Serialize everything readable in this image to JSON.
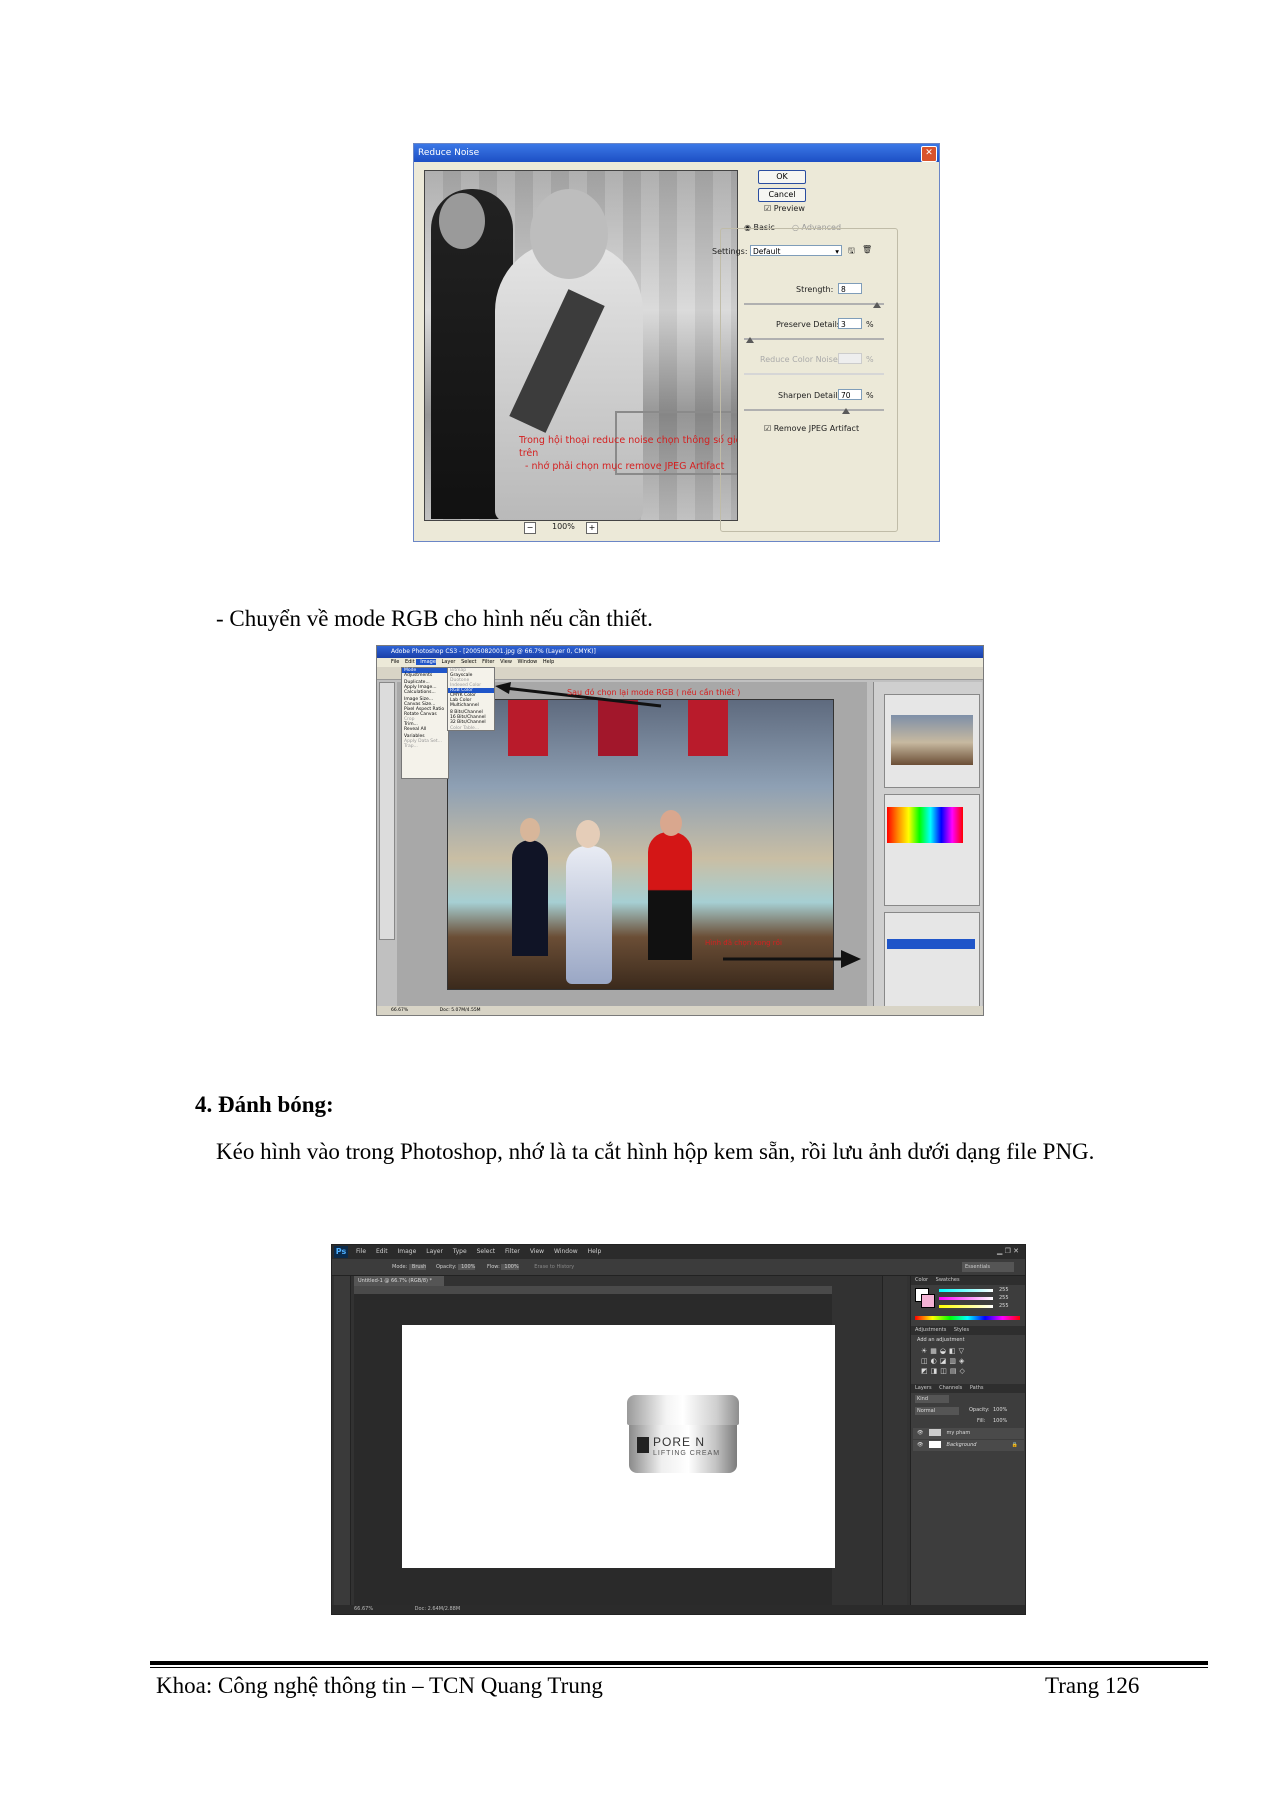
{
  "figure1": {
    "title": "Reduce Noise",
    "ok_label": "OK",
    "cancel_label": "Cancel",
    "preview_label": "Preview",
    "basic_label": "Basic",
    "advanced_label": "Advanced",
    "settings_label": "Settings:",
    "settings_value": "Default",
    "strength_label": "Strength:",
    "strength_value": "8",
    "preserve_label": "Preserve Details:",
    "preserve_value": "3",
    "reduce_color_label": "Reduce Color Noise:",
    "sharpen_label": "Sharpen Details:",
    "sharpen_value": "70",
    "percent": "%",
    "remove_jpeg_label": "Remove JPEG Artifact",
    "zoom": "100%",
    "caption_line1": "Trong hội thoại reduce noise chọn thông số giống như bảng trên",
    "caption_line2": "- nhớ phải chọn mục remove JPEG Artifact"
  },
  "text": {
    "line_rgb": "- Chuyển về mode RGB cho hình nếu cần thiết.",
    "heading": "4.  Đánh bóng:",
    "paragraph": "Kéo hình vào trong Photoshop, nhớ là ta cắt hình hộp kem sẵn, rồi lưu ảnh dưới dạng file PNG."
  },
  "figure2": {
    "title": "Adobe Photoshop CS3 - [2005082001.jpg @ 66.7% (Layer 0, CMYK)]",
    "menu": [
      "File",
      "Edit",
      "Image",
      "Layer",
      "Select",
      "Filter",
      "View",
      "Window",
      "Help"
    ],
    "image_menu": [
      "Mode",
      "Adjustments",
      "Duplicate...",
      "Apply Image...",
      "Calculations...",
      "Image Size...",
      "Canvas Size...",
      "Pixel Aspect Ratio",
      "Rotate Canvas",
      "Crop",
      "Trim...",
      "Reveal All",
      "Variables",
      "Apply Data Set...",
      "Trap..."
    ],
    "mode_menu": [
      "Bitmap",
      "Grayscale",
      "Duotone",
      "Indexed Color",
      "RGB Color",
      "CMYK Color",
      "Lab Color",
      "Multichannel",
      "8 Bits/Channel",
      "16 Bits/Channel",
      "32 Bits/Channel",
      "Color Table..."
    ],
    "note_top": "Sau đó chọn lại mode RGB ( nếu cần thiết )",
    "note_bottom": "Hình đã chọn xong rồi",
    "zoom": "66.67%",
    "doc_size": "Doc: 5.07M/4.55M"
  },
  "figure3": {
    "ps_badge": "Ps",
    "menu": [
      "File",
      "Edit",
      "Image",
      "Layer",
      "Type",
      "Select",
      "Filter",
      "View",
      "Window",
      "Help"
    ],
    "workspace": "Essentials",
    "options": [
      "Mode:",
      "Brush",
      "Opacity:",
      "100%",
      "Flow:",
      "100%",
      "Erase to History"
    ],
    "doc_tab": "Untitled-1 @ 66.7% (RGB/8) *",
    "panel_tabs": [
      "Color",
      "Swatches",
      "Adjustments",
      "Styles",
      "Layers",
      "Channels",
      "Paths"
    ],
    "color_values": [
      "255",
      "255",
      "255"
    ],
    "add_adjustment": "Add an adjustment",
    "kind": "Kind",
    "blend_mode": "Normal",
    "opacity_label": "Opacity:",
    "opacity_value": "100%",
    "fill_label": "Fill:",
    "fill_value": "100%",
    "layers": [
      "my pham",
      "Background"
    ],
    "zoom": "66.67%",
    "doc_size": "Doc: 2.64M/2.88M",
    "jar_brand": "PORE N",
    "jar_sub": "LIFTING CREAM"
  },
  "footer": {
    "left": "Khoa: Công nghệ thông tin – TCN Quang Trung",
    "right": "Trang 126"
  }
}
